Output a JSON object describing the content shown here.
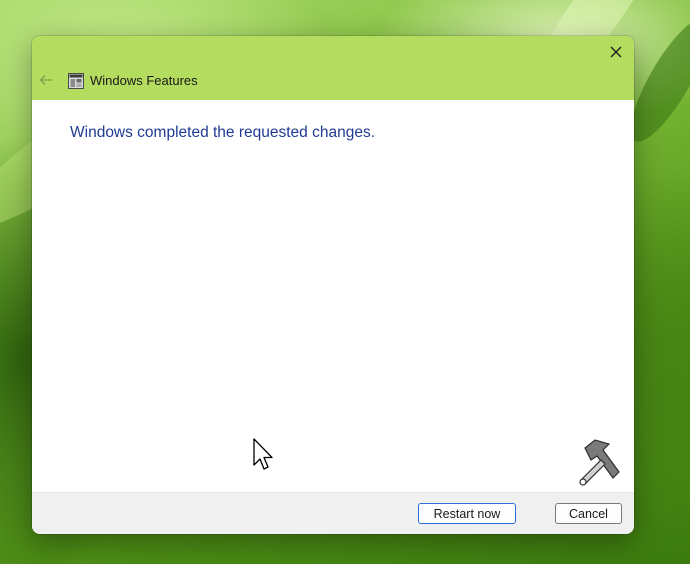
{
  "window": {
    "title": "Windows Features",
    "message": "Windows completed the requested changes."
  },
  "icons": {
    "back": "back-arrow-icon",
    "app": "windows-features-icon",
    "close": "close-icon",
    "cursor": "mouse-pointer-icon",
    "watermark": "hammer-wrench-icon"
  },
  "footer": {
    "restart_label": "Restart now",
    "cancel_label": "Cancel"
  },
  "colors": {
    "titlebar": "#b4dc5e",
    "message_text": "#1f3b94"
  }
}
